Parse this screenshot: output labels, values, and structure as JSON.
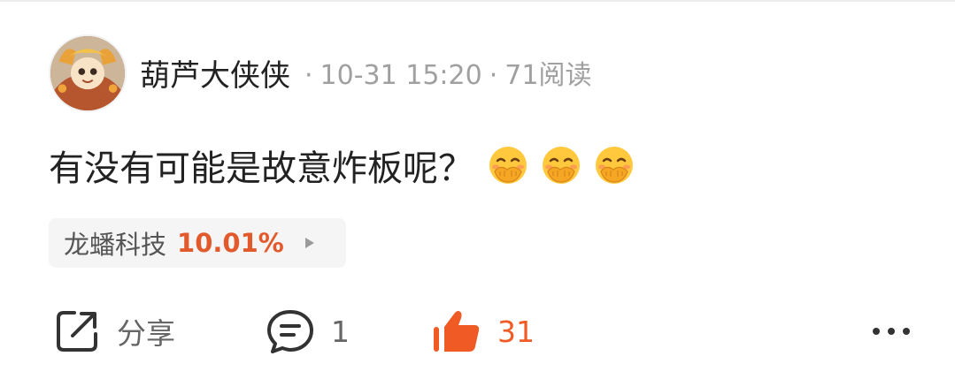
{
  "post": {
    "username": "葫芦大侠侠",
    "separator": "·",
    "date": "10-31 15:20",
    "reads": "71阅读",
    "text": "有没有可能是故意炸板呢？",
    "emojis": [
      "covering-mouth-laugh-emoji",
      "covering-mouth-laugh-emoji",
      "covering-mouth-laugh-emoji"
    ]
  },
  "stock_tag": {
    "name": "龙蟠科技",
    "change": "10.01%",
    "change_color": "#e25a2b"
  },
  "actions": {
    "share_label": "分享",
    "comment_count": "1",
    "like_count": "31",
    "like_color": "#f05a24",
    "icons": [
      "share-icon",
      "comment-icon",
      "thumbs-up-icon",
      "more-icon"
    ]
  }
}
